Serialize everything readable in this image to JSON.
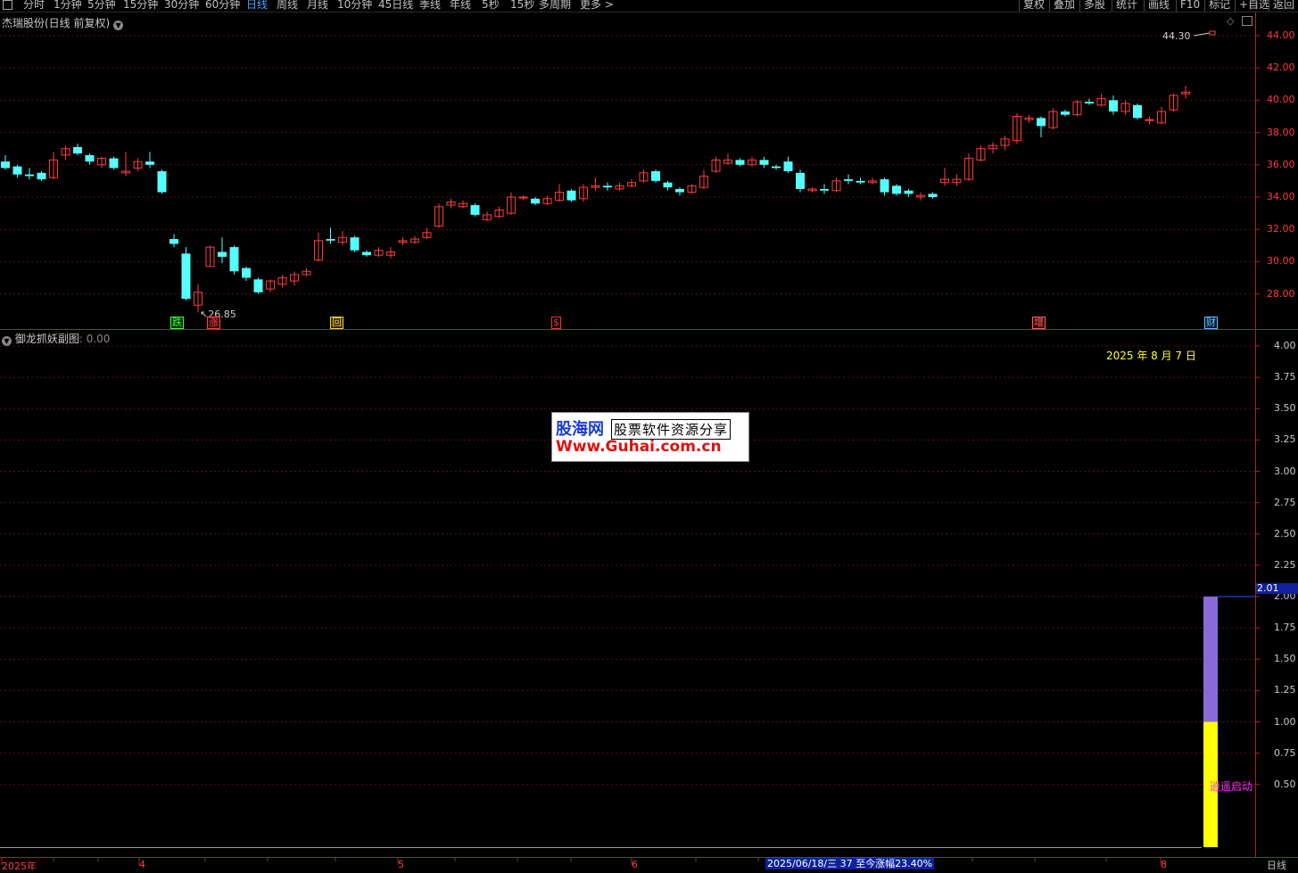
{
  "toolbar": {
    "left_items": [
      "分时",
      "1分钟",
      "5分钟",
      "15分钟",
      "30分钟",
      "60分钟",
      "日线",
      "周线",
      "月线",
      "10分钟",
      "45日线",
      "季线",
      "年线",
      "5秒",
      "15秒",
      "多周期",
      "更多 >"
    ],
    "active": "日线",
    "right_items": [
      "复权",
      "叠加",
      "多股",
      "统计",
      "画线",
      "F10",
      "标记",
      "+自选",
      "返回"
    ]
  },
  "main_pane": {
    "title": "杰瑞股份(日线 前复权)",
    "y_ticks": [
      "44.00",
      "42.00",
      "40.00",
      "38.00",
      "36.00",
      "34.00",
      "32.00",
      "30.00",
      "28.00"
    ],
    "high_label": "44.30",
    "low_label": "26.85",
    "markers": [
      {
        "text": "跌",
        "color": "#40ff40",
        "bg": "#0a300a"
      },
      {
        "text": "涨",
        "color": "#ff4040",
        "bg": "#300a0a"
      },
      {
        "text": "回",
        "color": "#ffd040",
        "bg": "#302a0a"
      },
      {
        "text": "$",
        "color": "#ff3030",
        "bg": "#000000"
      },
      {
        "text": "增",
        "color": "#ff6060",
        "bg": "#300a0a"
      },
      {
        "text": "财",
        "color": "#60c0ff",
        "bg": "#0a1a30"
      }
    ]
  },
  "sub_pane": {
    "title": "御龙抓妖副图",
    "value": ": 0.00",
    "date_label": "2025 年 8 月 7 日",
    "y_ticks": [
      "4.00",
      "3.75",
      "3.50",
      "3.25",
      "3.00",
      "2.75",
      "2.50",
      "2.25",
      "2.00",
      "1.75",
      "1.50",
      "1.25",
      "1.00",
      "0.75",
      "0.50"
    ],
    "current_value": "2.01",
    "signal_text": "逍遥启动",
    "bars": [
      {
        "from": 0,
        "to": 1.0,
        "color": "#ffff00"
      },
      {
        "from": 1.0,
        "to": 2.0,
        "color": "#8a6bd6"
      }
    ]
  },
  "watermark": {
    "line1a": "股海网",
    "line1b": "股票软件资源分享",
    "line2": "Www.Guhai.com.cn"
  },
  "bottom_axis": {
    "labels": [
      "2025年",
      "4",
      "5",
      "6",
      "8"
    ],
    "info": "2025/06/18/三  37 至今涨幅23.40%",
    "period": "日线"
  },
  "chart_data": {
    "type": "candlestick",
    "title": "杰瑞股份(日线 前复权)",
    "ylim": [
      26,
      44.5
    ],
    "candles": [
      [
        36.2,
        35.8,
        36.6,
        35.7
      ],
      [
        35.9,
        35.4,
        36.0,
        35.2
      ],
      [
        35.4,
        35.3,
        35.8,
        35.1
      ],
      [
        35.5,
        35.1,
        35.6,
        35.0
      ],
      [
        35.2,
        36.3,
        36.8,
        35.1
      ],
      [
        36.6,
        37.0,
        37.2,
        36.3
      ],
      [
        37.1,
        36.7,
        37.3,
        36.6
      ],
      [
        36.6,
        36.2,
        36.7,
        36.0
      ],
      [
        36.0,
        36.4,
        36.5,
        35.8
      ],
      [
        36.4,
        35.8,
        36.5,
        35.7
      ],
      [
        35.5,
        35.6,
        36.8,
        35.3
      ],
      [
        35.8,
        36.2,
        36.4,
        35.6
      ],
      [
        36.2,
        36.0,
        36.8,
        35.8
      ],
      [
        35.6,
        34.3,
        35.7,
        34.2
      ],
      [
        31.4,
        31.1,
        31.7,
        30.9
      ],
      [
        30.5,
        27.7,
        30.9,
        27.6
      ],
      [
        27.3,
        28.1,
        28.6,
        26.85
      ],
      [
        29.7,
        30.9,
        31.0,
        29.7
      ],
      [
        30.6,
        30.3,
        31.5,
        29.9
      ],
      [
        30.9,
        29.4,
        31.0,
        29.2
      ],
      [
        29.6,
        29.0,
        29.7,
        28.8
      ],
      [
        28.9,
        28.1,
        29.0,
        28.0
      ],
      [
        28.3,
        28.8,
        28.9,
        28.1
      ],
      [
        28.6,
        29.0,
        29.2,
        28.4
      ],
      [
        28.8,
        29.2,
        29.4,
        28.5
      ],
      [
        29.2,
        29.4,
        29.6,
        29.1
      ],
      [
        30.1,
        31.3,
        31.8,
        30.0
      ],
      [
        31.4,
        31.3,
        32.1,
        31.1
      ],
      [
        31.2,
        31.5,
        31.9,
        31.0
      ],
      [
        31.5,
        30.7,
        31.6,
        30.6
      ],
      [
        30.6,
        30.4,
        30.7,
        30.3
      ],
      [
        30.4,
        30.7,
        30.9,
        30.3
      ],
      [
        30.4,
        30.6,
        30.9,
        30.2
      ],
      [
        31.2,
        31.3,
        31.5,
        31.0
      ],
      [
        31.2,
        31.4,
        31.6,
        31.1
      ],
      [
        31.5,
        31.8,
        32.1,
        31.4
      ],
      [
        32.2,
        33.4,
        33.6,
        32.1
      ],
      [
        33.5,
        33.7,
        33.9,
        33.3
      ],
      [
        33.4,
        33.6,
        33.8,
        33.3
      ],
      [
        33.5,
        32.9,
        33.6,
        32.8
      ],
      [
        32.6,
        32.9,
        33.1,
        32.5
      ],
      [
        32.8,
        33.2,
        33.4,
        32.7
      ],
      [
        33.0,
        34.0,
        34.3,
        32.9
      ],
      [
        34.0,
        34.0,
        34.1,
        33.8
      ],
      [
        33.9,
        33.6,
        34.0,
        33.5
      ],
      [
        33.6,
        33.9,
        34.1,
        33.5
      ],
      [
        33.8,
        34.3,
        34.8,
        33.7
      ],
      [
        34.4,
        33.8,
        34.5,
        33.7
      ],
      [
        33.9,
        34.6,
        34.8,
        33.7
      ],
      [
        34.6,
        34.7,
        35.2,
        34.4
      ],
      [
        34.7,
        34.6,
        34.9,
        34.4
      ],
      [
        34.5,
        34.7,
        34.9,
        34.4
      ],
      [
        34.7,
        34.9,
        35.1,
        34.6
      ],
      [
        35.0,
        35.5,
        35.7,
        34.9
      ],
      [
        35.6,
        35.0,
        35.7,
        34.9
      ],
      [
        34.9,
        34.6,
        35.0,
        34.4
      ],
      [
        34.5,
        34.3,
        34.6,
        34.1
      ],
      [
        34.3,
        34.7,
        34.8,
        34.2
      ],
      [
        34.6,
        35.3,
        35.7,
        34.5
      ],
      [
        35.6,
        36.3,
        36.5,
        35.5
      ],
      [
        36.1,
        36.3,
        36.7,
        36.0
      ],
      [
        36.3,
        36.0,
        36.4,
        35.9
      ],
      [
        36.0,
        36.3,
        36.5,
        35.9
      ],
      [
        36.3,
        36.0,
        36.5,
        35.8
      ],
      [
        35.9,
        35.8,
        36.0,
        35.7
      ],
      [
        36.2,
        35.6,
        36.5,
        35.5
      ],
      [
        35.5,
        34.5,
        35.7,
        34.3
      ],
      [
        34.4,
        34.5,
        34.6,
        34.3
      ],
      [
        34.5,
        34.4,
        34.8,
        34.2
      ],
      [
        34.4,
        35.0,
        35.2,
        34.3
      ],
      [
        35.1,
        35.0,
        35.4,
        34.8
      ],
      [
        35.0,
        34.9,
        35.2,
        34.8
      ],
      [
        34.9,
        35.0,
        35.2,
        34.8
      ],
      [
        35.1,
        34.3,
        35.2,
        34.1
      ],
      [
        34.7,
        34.2,
        34.8,
        34.1
      ],
      [
        34.4,
        34.2,
        34.5,
        34.0
      ],
      [
        34.0,
        34.1,
        34.3,
        33.8
      ],
      [
        34.2,
        34.0,
        34.3,
        33.9
      ],
      [
        34.9,
        35.1,
        35.8,
        34.7
      ],
      [
        34.9,
        35.1,
        35.4,
        34.7
      ],
      [
        35.1,
        36.4,
        36.7,
        35.0
      ],
      [
        36.3,
        37.0,
        37.2,
        36.2
      ],
      [
        37.0,
        37.2,
        37.4,
        36.7
      ],
      [
        37.2,
        37.6,
        37.8,
        36.9
      ],
      [
        37.5,
        39.0,
        39.2,
        37.3
      ],
      [
        38.8,
        38.9,
        39.1,
        38.6
      ],
      [
        38.9,
        38.4,
        39.0,
        37.7
      ],
      [
        38.3,
        39.3,
        39.5,
        38.2
      ],
      [
        39.3,
        39.1,
        39.4,
        39.0
      ],
      [
        39.1,
        39.9,
        40.0,
        39.0
      ],
      [
        39.9,
        39.8,
        40.1,
        39.7
      ],
      [
        39.7,
        40.1,
        40.4,
        39.6
      ],
      [
        40.0,
        39.3,
        40.3,
        39.1
      ],
      [
        39.3,
        39.8,
        40.0,
        39.1
      ],
      [
        39.7,
        38.9,
        39.8,
        38.8
      ],
      [
        38.8,
        38.8,
        39.0,
        38.5
      ],
      [
        38.6,
        39.3,
        39.6,
        38.5
      ],
      [
        39.4,
        40.3,
        40.4,
        39.3
      ],
      [
        40.4,
        40.5,
        40.9,
        40.1
      ]
    ],
    "sub_series": {
      "name": "御龙抓妖副图",
      "ylim": [
        0,
        4.15
      ]
    }
  }
}
